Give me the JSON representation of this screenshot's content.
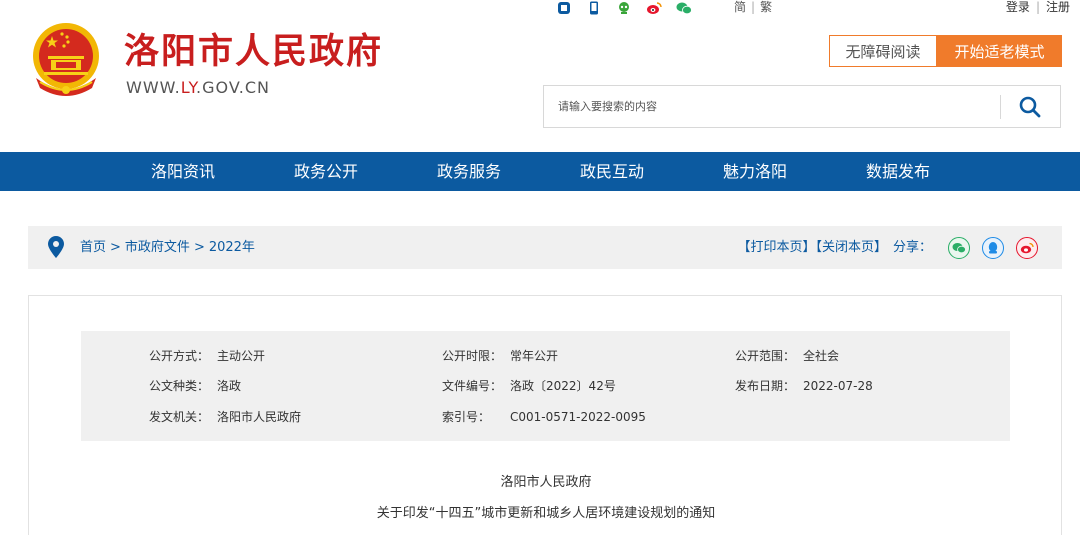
{
  "top_bar": {
    "icons": [
      "gov-app-icon",
      "mobile-icon",
      "robot-icon",
      "weibo-icon",
      "wechat-icon"
    ],
    "lang_simplified": "简",
    "lang_traditional": "繁",
    "login": "登录",
    "register": "注册"
  },
  "header": {
    "title": "洛阳市人民政府",
    "url_prefix": "WWW.",
    "url_accent": "LY",
    "url_suffix": ".GOV.CN",
    "accessible_reading": "无障碍阅读",
    "elder_mode": "开始适老模式",
    "search_placeholder": "请输入要搜索的内容"
  },
  "nav": {
    "items": [
      "洛阳资讯",
      "政务公开",
      "政务服务",
      "政民互动",
      "魅力洛阳",
      "数据发布"
    ]
  },
  "breadcrumb": {
    "items": [
      "首页",
      "市政府文件",
      "2022年"
    ],
    "print": "【打印本页】",
    "close": "【关闭本页】",
    "share_label": "分享："
  },
  "meta": {
    "disclosure_method": {
      "label": "公开方式：",
      "value": "主动公开"
    },
    "disclosure_period": {
      "label": "公开时限：",
      "value": "常年公开"
    },
    "disclosure_scope": {
      "label": "公开范围：",
      "value": "全社会"
    },
    "doc_type": {
      "label": "公文种类：",
      "value": "洛政"
    },
    "doc_number": {
      "label": "文件编号：",
      "value": "洛政〔2022〕42号"
    },
    "publish_date": {
      "label": "发布日期：",
      "value": "2022-07-28"
    },
    "issuing_authority": {
      "label": "发文机关：",
      "value": "洛阳市人民政府"
    },
    "index_number": {
      "label": "索引号：",
      "value": "C001-0571-2022-0095"
    }
  },
  "document": {
    "issuer": "洛阳市人民政府",
    "title": "关于印发“十四五”城市更新和城乡人居环境建设规划的通知"
  },
  "colors": {
    "brand_red": "#c81e1e",
    "nav_blue": "#0c5aa0",
    "accent_orange": "#f07b2b"
  }
}
